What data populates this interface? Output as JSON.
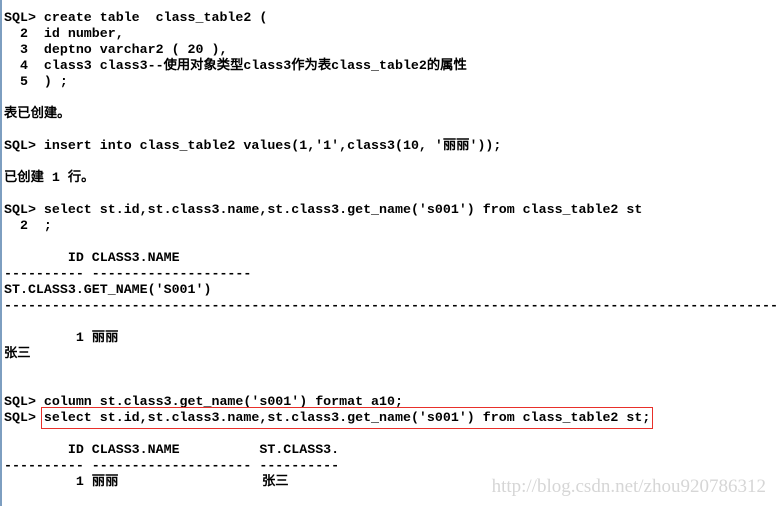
{
  "console": {
    "lines": [
      "SQL> create table  class_table2 (",
      "  2  id number,",
      "  3  deptno varchar2 ( 20 ),",
      "  4  class3 class3--使用对象类型class3作为表class_table2的属性",
      "  5  ) ;",
      "",
      "表已创建。",
      "",
      "SQL> insert into class_table2 values(1,'1',class3(10, '丽丽'));",
      "",
      "已创建 1 行。",
      "",
      "SQL> select st.id,st.class3.name,st.class3.get_name('s001') from class_table2 st",
      "  2  ;",
      "",
      "        ID CLASS3.NAME",
      "---------- --------------------",
      "ST.CLASS3.GET_NAME('S001')",
      "--------------------------------------------------------------------------------------------------",
      "",
      "         1 丽丽",
      "张三",
      "",
      "",
      "SQL> column st.class3.get_name('s001') format a10;",
      "SQL> select st.id,st.class3.name,st.class3.get_name('s001') from class_table2 st;",
      "",
      "        ID CLASS3.NAME          ST.CLASS3.",
      "---------- -------------------- ----------",
      "         1 丽丽                  张三"
    ],
    "highlighted_line": 25,
    "highlight_color": "#e8302a"
  },
  "watermark": "http://blog.csdn.net/zhou920786312"
}
